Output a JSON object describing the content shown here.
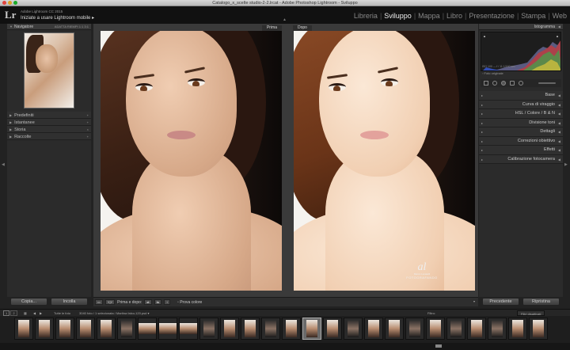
{
  "window": {
    "title": "Catalogo_x_scelte studio-2-2.lrcat - Adobe Photoshop Lightroom - Sviluppo"
  },
  "identity": {
    "logo": "Lr",
    "version": "Adobe Lightroom CC 2015",
    "task": "Iniziate a usare Lightroom mobile",
    "task_arrow": "▸"
  },
  "modules": [
    "Libreria",
    "Sviluppo",
    "Mappa",
    "Libro",
    "Presentazione",
    "Stampa",
    "Web"
  ],
  "active_module": "Sviluppo",
  "left_panel": {
    "navigator": {
      "title": "Navigatore",
      "zoom_options": "ADATTA  RIEMPI  1:1  3:1"
    },
    "sections": [
      {
        "label": "Predefiniti",
        "tail": "+"
      },
      {
        "label": "Istantanee",
        "tail": "+"
      },
      {
        "label": "Storia",
        "tail": "×"
      },
      {
        "label": "Raccolte",
        "tail": "+"
      }
    ],
    "copy_button": "Copia...",
    "paste_button": "Incolla"
  },
  "viewer": {
    "before_label": "Prima",
    "after_label": "Dopo"
  },
  "watermark": {
    "signature": "al",
    "name": "Marco Locatelli",
    "title": "FOTOGRAFANDO"
  },
  "toolbar": {
    "view_icon": "▭",
    "before_after_icon": "Y|Y",
    "before_after_label": "Prima e dopo:",
    "soft_proof": "Prova colore",
    "dropdown": "▾"
  },
  "right_panel": {
    "histogram_title": "Istogramma",
    "readout": "ISO 100    —    f / 11    1/160 sec",
    "original_photo": "Foto originale",
    "sections": [
      {
        "label": "Base"
      },
      {
        "label": "Curva di viraggio"
      },
      {
        "label": "HSL  /  Colore  /  B & N"
      },
      {
        "label": "Divisione toni"
      },
      {
        "label": "Dettagli"
      },
      {
        "label": "Correzioni obiettivo"
      },
      {
        "label": "Effetti"
      },
      {
        "label": "Calibrazione fotocamera"
      }
    ],
    "previous_button": "Precedente",
    "reset_button": "Ripristina"
  },
  "filmstrip": {
    "screens": [
      "1",
      "2"
    ],
    "source": "Tutte le foto",
    "info": "3040 foto / 1 selezionata / Martina falco-120.psd ▾",
    "filter_label": "Filtro:",
    "filter_value": "Filtri disattivati",
    "thumb_count": 26,
    "selected_index": 14
  },
  "colors": {
    "background": "#222222",
    "panel": "#2b2b2b",
    "active_module": "#eeeeee",
    "inactive_module": "#888888"
  }
}
